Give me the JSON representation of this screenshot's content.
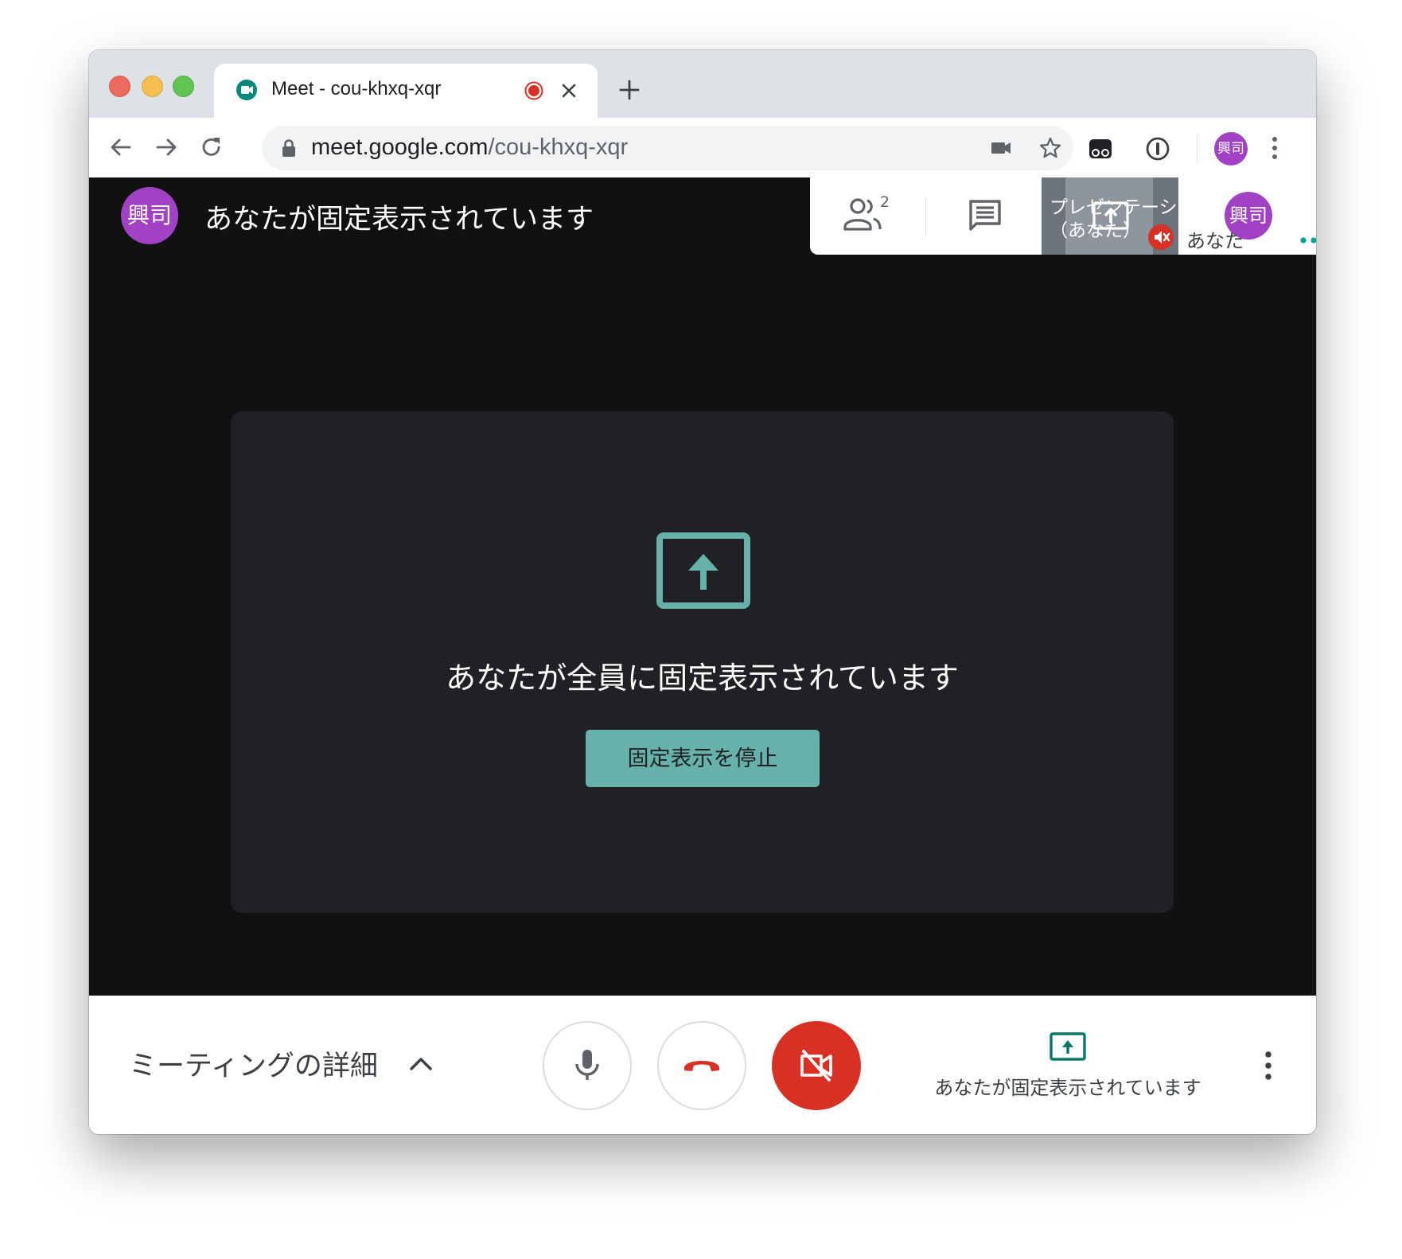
{
  "browser": {
    "tab": {
      "title": "Meet - cou-khxq-xqr",
      "favicon": "google-meet-icon",
      "recording_indicator": "#d93025"
    },
    "address_bar": {
      "domain": "meet.google.com",
      "path": "/cou-khxq-xqr"
    },
    "profile_initials": "興司"
  },
  "meet": {
    "header": {
      "avatar_initials": "興司",
      "pinned_text": "あなたが固定表示されています"
    },
    "top_panel": {
      "people_count": "2",
      "presentation_label_line1": "プレゼンテーシ",
      "presentation_label_line2": "（あなた）",
      "self_avatar_initials": "興司",
      "self_label": "あなた"
    },
    "pin_card": {
      "message": "あなたが全員に固定表示されています",
      "stop_button": "固定表示を停止"
    },
    "controls": {
      "details_label": "ミーティングの詳細",
      "pinned_status": "あなたが固定表示されています"
    },
    "colors": {
      "accent_teal": "#66b2aa",
      "hangup_red": "#d93025",
      "avatar_purple": "#a142c5",
      "stage_bg": "#111111",
      "card_bg": "#202124"
    }
  }
}
